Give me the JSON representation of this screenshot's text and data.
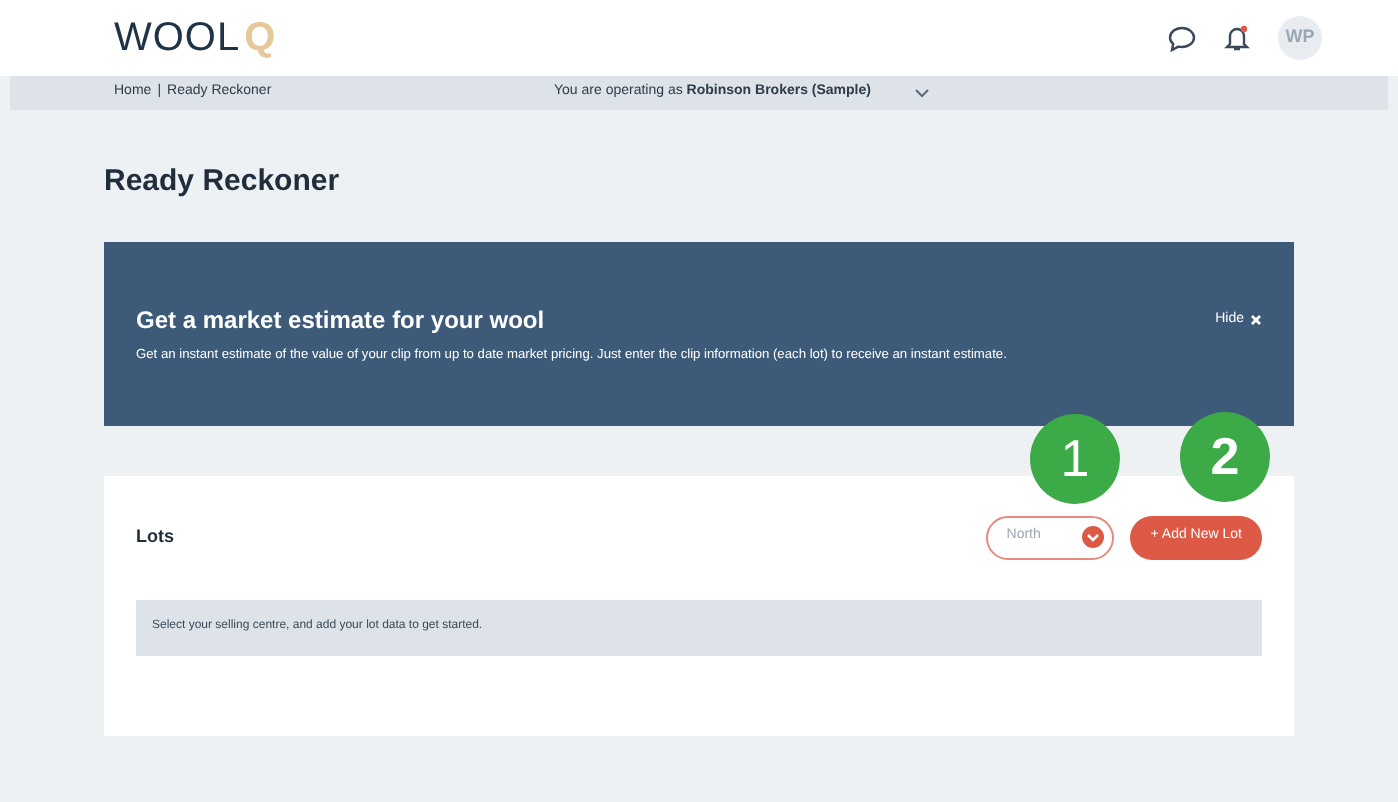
{
  "header": {
    "logo": {
      "text": "WOOL",
      "mark": "Q"
    },
    "avatar": "WP"
  },
  "context_bar": {
    "breadcrumb": [
      "Home",
      "Ready Reckoner"
    ],
    "separator": "|",
    "operating_as": "You are operating as **Robinson Brokers (Sample)**"
  },
  "page_title": "Ready Reckoner",
  "banner": {
    "title": "Get a market estimate for your wool",
    "text": "Get an instant estimate of the value of your clip from up to date market pricing. Just enter the clip information (each lot) to receive an instant estimate.",
    "hide": "Hide"
  },
  "lots_card": {
    "title": "Lots",
    "selling_centre": "North",
    "add_button": "+ Add New Lot",
    "empty_message": "Select your selling centre, and add your lot data to get started."
  },
  "callouts": [
    "1",
    "2"
  ]
}
